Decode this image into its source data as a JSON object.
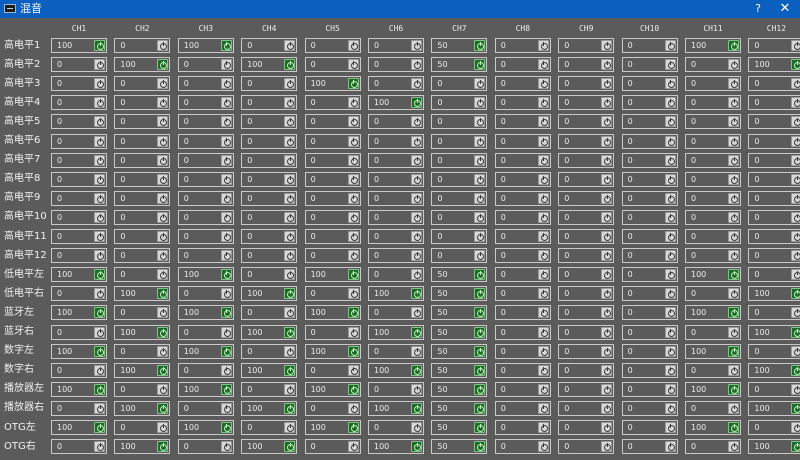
{
  "window": {
    "title": "混音",
    "help_label": "?",
    "close_label": "✕"
  },
  "channels": [
    "CH1",
    "CH2",
    "CH3",
    "CH4",
    "CH5",
    "CH6",
    "CH7",
    "CH8",
    "CH9",
    "CH10",
    "CH11",
    "CH12"
  ],
  "rows": [
    {
      "label": "高电平1",
      "values": [
        100,
        0,
        100,
        0,
        0,
        0,
        50,
        0,
        0,
        0,
        100,
        0
      ]
    },
    {
      "label": "高电平2",
      "values": [
        0,
        100,
        0,
        100,
        0,
        0,
        50,
        0,
        0,
        0,
        0,
        100
      ]
    },
    {
      "label": "高电平3",
      "values": [
        0,
        0,
        0,
        0,
        100,
        0,
        0,
        0,
        0,
        0,
        0,
        0
      ]
    },
    {
      "label": "高电平4",
      "values": [
        0,
        0,
        0,
        0,
        0,
        100,
        0,
        0,
        0,
        0,
        0,
        0
      ]
    },
    {
      "label": "高电平5",
      "values": [
        0,
        0,
        0,
        0,
        0,
        0,
        0,
        0,
        0,
        0,
        0,
        0
      ]
    },
    {
      "label": "高电平6",
      "values": [
        0,
        0,
        0,
        0,
        0,
        0,
        0,
        0,
        0,
        0,
        0,
        0
      ]
    },
    {
      "label": "高电平7",
      "values": [
        0,
        0,
        0,
        0,
        0,
        0,
        0,
        0,
        0,
        0,
        0,
        0
      ]
    },
    {
      "label": "高电平8",
      "values": [
        0,
        0,
        0,
        0,
        0,
        0,
        0,
        0,
        0,
        0,
        0,
        0
      ]
    },
    {
      "label": "高电平9",
      "values": [
        0,
        0,
        0,
        0,
        0,
        0,
        0,
        0,
        0,
        0,
        0,
        0
      ]
    },
    {
      "label": "高电平10",
      "values": [
        0,
        0,
        0,
        0,
        0,
        0,
        0,
        0,
        0,
        0,
        0,
        0
      ]
    },
    {
      "label": "高电平11",
      "values": [
        0,
        0,
        0,
        0,
        0,
        0,
        0,
        0,
        0,
        0,
        0,
        0
      ]
    },
    {
      "label": "高电平12",
      "values": [
        0,
        0,
        0,
        0,
        0,
        0,
        0,
        0,
        0,
        0,
        0,
        0
      ]
    },
    {
      "label": "低电平左",
      "values": [
        100,
        0,
        100,
        0,
        100,
        0,
        50,
        0,
        0,
        0,
        100,
        0
      ]
    },
    {
      "label": "低电平右",
      "values": [
        0,
        100,
        0,
        100,
        0,
        100,
        50,
        0,
        0,
        0,
        0,
        100
      ]
    },
    {
      "label": "蓝牙左",
      "values": [
        100,
        0,
        100,
        0,
        100,
        0,
        50,
        0,
        0,
        0,
        100,
        0
      ]
    },
    {
      "label": "蓝牙右",
      "values": [
        0,
        100,
        0,
        100,
        0,
        100,
        50,
        0,
        0,
        0,
        0,
        100
      ]
    },
    {
      "label": "数字左",
      "values": [
        100,
        0,
        100,
        0,
        100,
        0,
        50,
        0,
        0,
        0,
        100,
        0
      ]
    },
    {
      "label": "数字右",
      "values": [
        0,
        100,
        0,
        100,
        0,
        100,
        50,
        0,
        0,
        0,
        0,
        100
      ]
    },
    {
      "label": "播放器左",
      "values": [
        100,
        0,
        100,
        0,
        100,
        0,
        50,
        0,
        0,
        0,
        100,
        0
      ]
    },
    {
      "label": "播放器右",
      "values": [
        0,
        100,
        0,
        100,
        0,
        100,
        50,
        0,
        0,
        0,
        0,
        100
      ]
    },
    {
      "label": "OTG左",
      "values": [
        100,
        0,
        100,
        0,
        100,
        0,
        50,
        0,
        0,
        0,
        100,
        0
      ]
    },
    {
      "label": "OTG右",
      "values": [
        0,
        100,
        0,
        100,
        0,
        100,
        50,
        0,
        0,
        0,
        0,
        100
      ]
    }
  ],
  "colors": {
    "titlebar": "#0a5fbf",
    "background": "#5b5b5b",
    "active_button": "#1f6a2c",
    "inactive_button": "#d8d8d8",
    "cell_border": "#c9c9c9"
  },
  "icons": {
    "app": "mixer-app-icon",
    "cell_button": "power-icon"
  }
}
